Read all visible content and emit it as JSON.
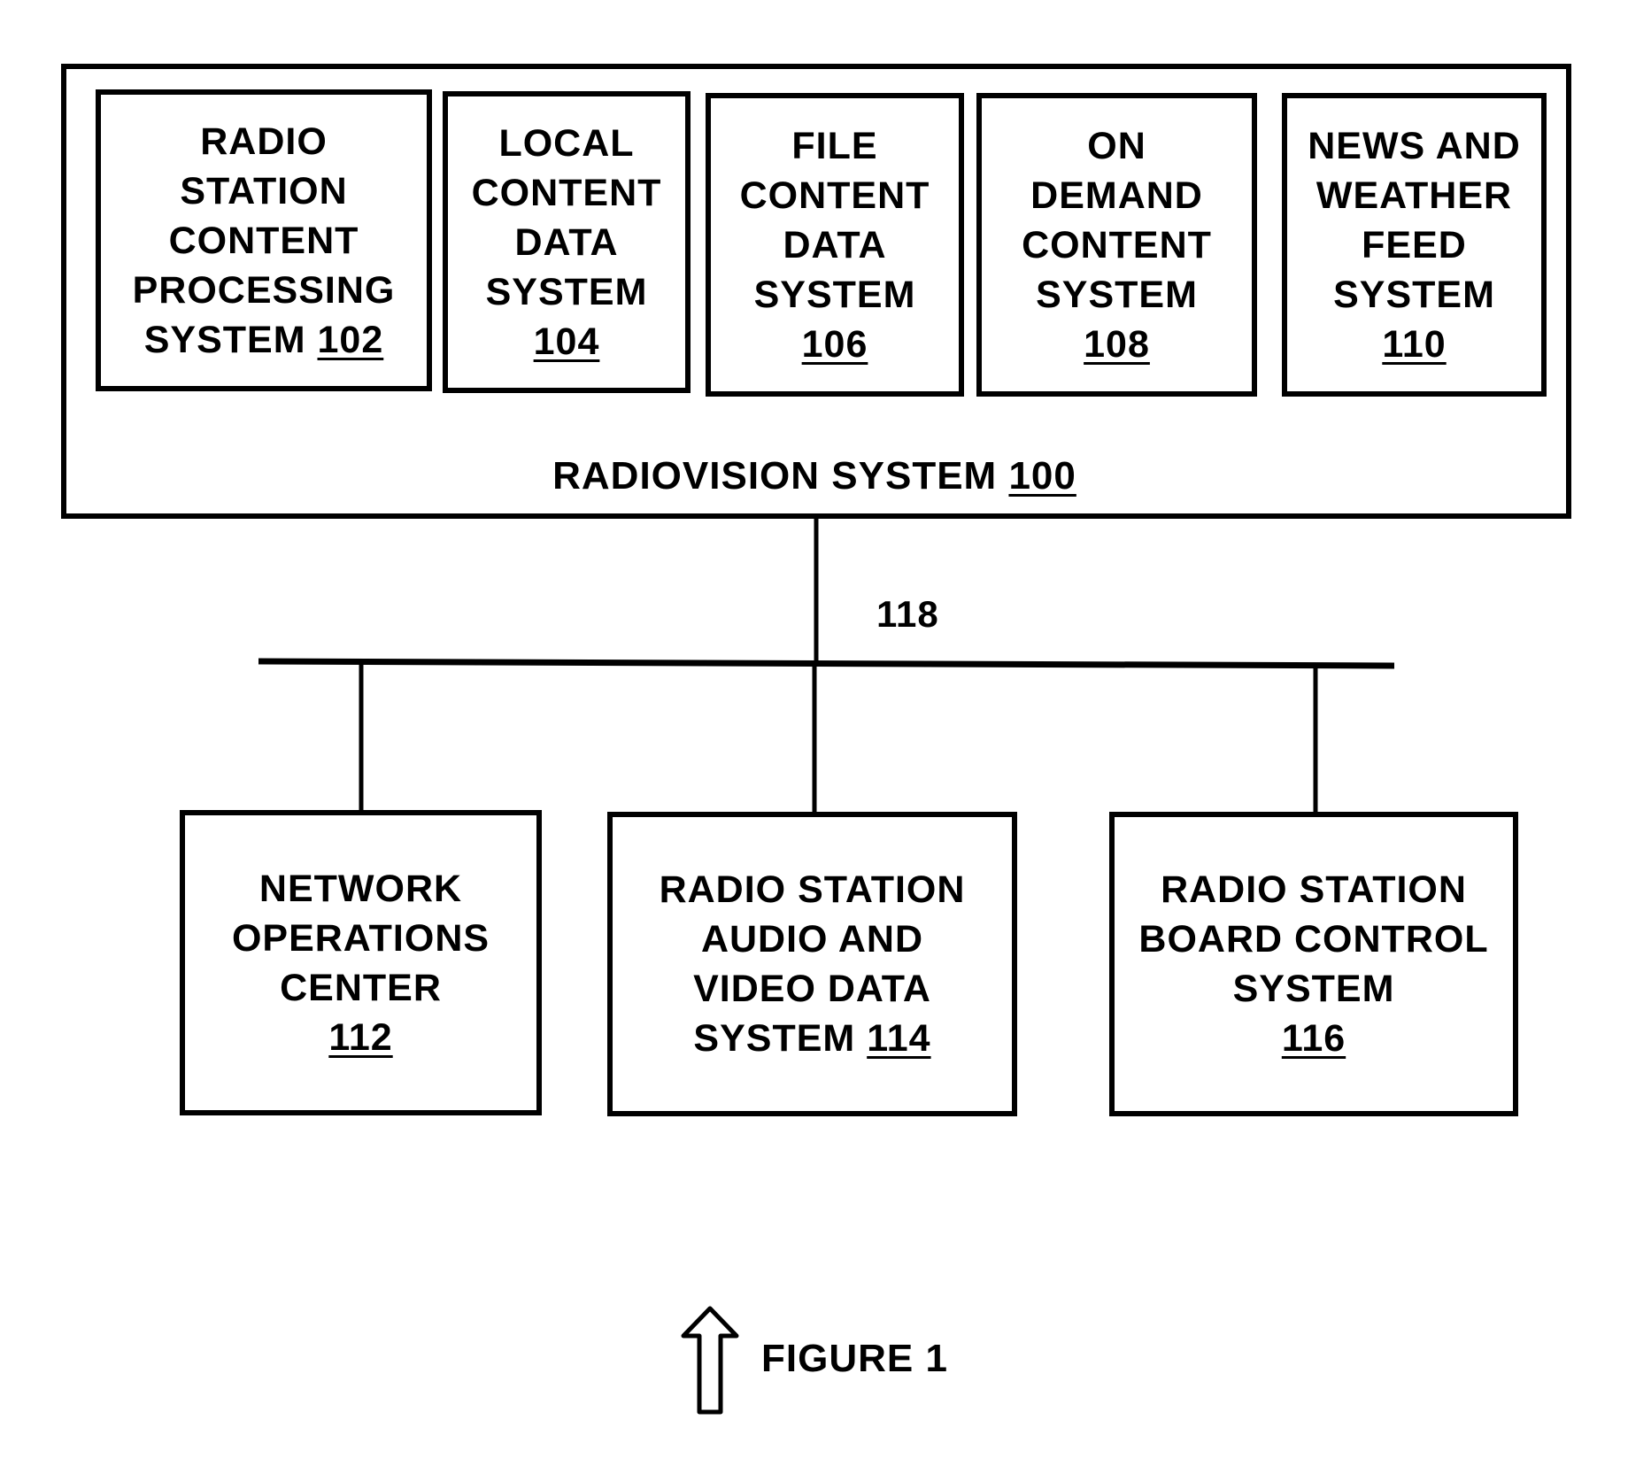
{
  "figure": {
    "caption": "FIGURE 1",
    "arrow_icon": "up-arrow-icon"
  },
  "system": {
    "name": "RADIOVISION SYSTEM",
    "ref": "100"
  },
  "bus": {
    "ref": "118"
  },
  "subsystems": [
    {
      "lines": [
        "RADIO",
        "STATION",
        "CONTENT",
        "PROCESSING",
        "SYSTEM"
      ],
      "ref": "102",
      "ref_inline": true
    },
    {
      "lines": [
        "LOCAL",
        "CONTENT",
        "DATA",
        "SYSTEM"
      ],
      "ref": "104",
      "ref_inline": false
    },
    {
      "lines": [
        "FILE",
        "CONTENT",
        "DATA",
        "SYSTEM"
      ],
      "ref": "106",
      "ref_inline": false
    },
    {
      "lines": [
        "ON",
        "DEMAND",
        "CONTENT",
        "SYSTEM"
      ],
      "ref": "108",
      "ref_inline": false
    },
    {
      "lines": [
        "NEWS AND",
        "WEATHER",
        "FEED",
        "SYSTEM"
      ],
      "ref": "110",
      "ref_inline": false
    }
  ],
  "connected": [
    {
      "lines": [
        "NETWORK",
        "OPERATIONS",
        "CENTER"
      ],
      "ref": "112",
      "ref_inline": false
    },
    {
      "lines": [
        "RADIO STATION",
        "AUDIO AND",
        "VIDEO DATA",
        "SYSTEM"
      ],
      "ref": "114",
      "ref_inline": true
    },
    {
      "lines": [
        "RADIO STATION",
        "BOARD CONTROL",
        "SYSTEM"
      ],
      "ref": "116",
      "ref_inline": false
    }
  ]
}
